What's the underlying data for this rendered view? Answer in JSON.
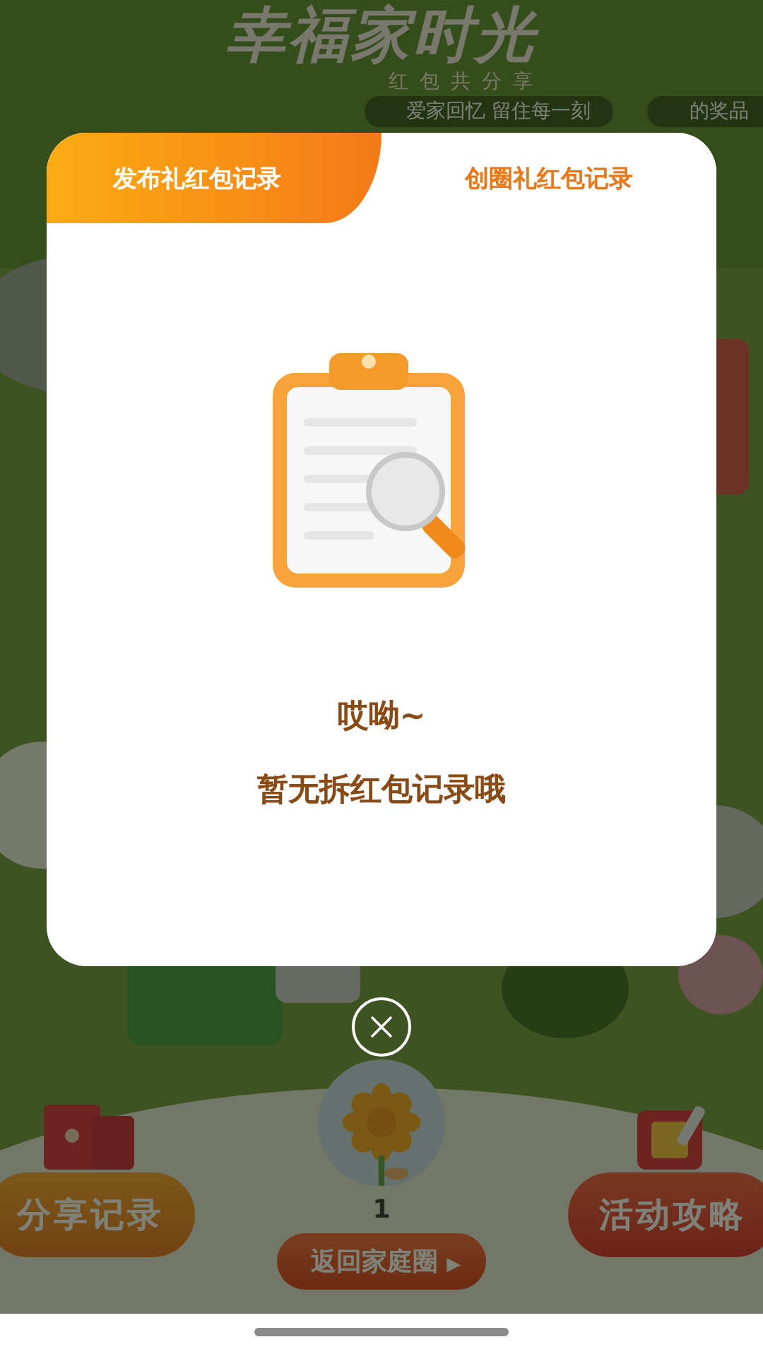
{
  "background": {
    "title": "幸福家时光",
    "subtitle": "红包共分享",
    "slogan": "爱家回忆  留住每一刻",
    "prize_label": "的奖品",
    "count": "1",
    "buttons": [
      {
        "label": "分享记录",
        "kind": "share"
      },
      {
        "label": "活动攻略",
        "kind": "guide"
      }
    ],
    "back_button": {
      "label": "返回家庭圈",
      "icon": "▶"
    }
  },
  "dialog": {
    "tabs": [
      {
        "label": "发布礼红包记录",
        "selected": true
      },
      {
        "label": "创圈礼红包记录",
        "selected": false
      }
    ],
    "empty_title": "哎呦~",
    "empty_message": "暂无拆红包记录哦"
  }
}
